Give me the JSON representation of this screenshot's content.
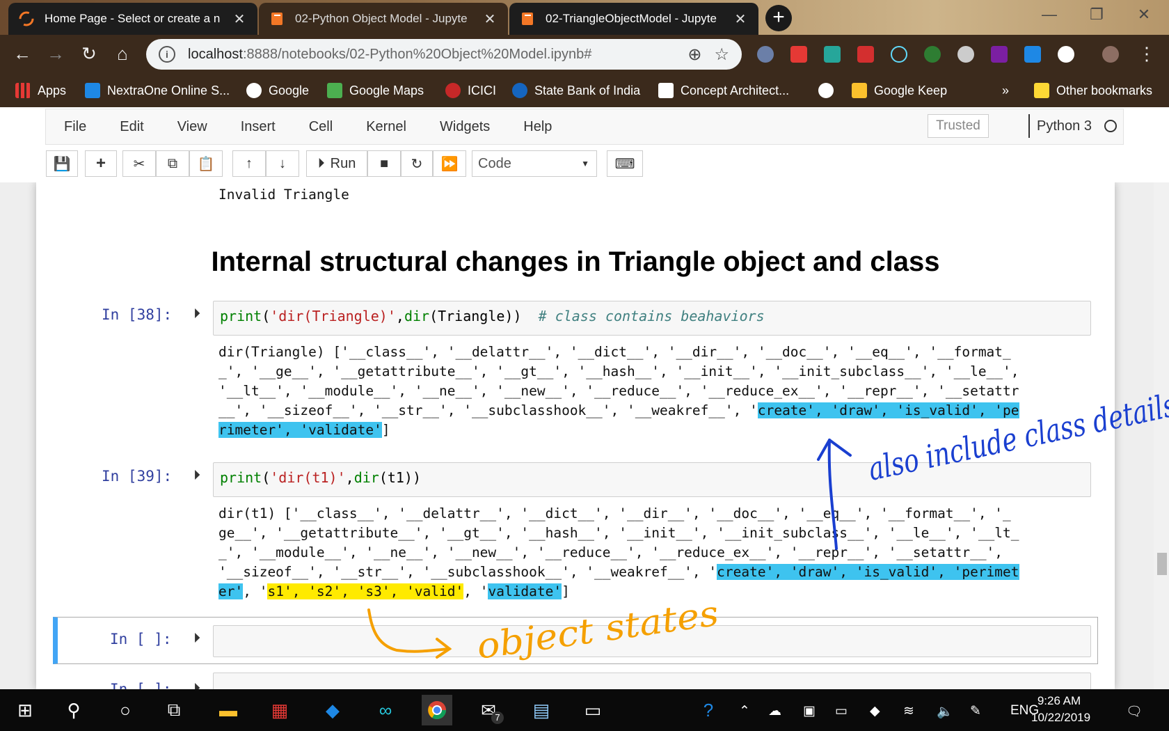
{
  "browser": {
    "tabs": [
      {
        "title": "Home Page - Select or create a n",
        "active": false
      },
      {
        "title": "02-Python Object Model - Jupyte",
        "active": true
      },
      {
        "title": "02-TriangleObjectModel - Jupyte",
        "active": false
      }
    ],
    "url_host": "localhost",
    "url_path": ":8888/notebooks/02-Python%20Object%20Model.ipynb#",
    "bookmarks": [
      "Apps",
      "NextraOne Online S...",
      "Google",
      "Google Maps",
      "ICICI",
      "State Bank of India",
      "Concept Architect...",
      "Google Keep",
      "»",
      "Other bookmarks"
    ]
  },
  "jupyter": {
    "menus": [
      "File",
      "Edit",
      "View",
      "Insert",
      "Cell",
      "Kernel",
      "Widgets",
      "Help"
    ],
    "trusted": "Trusted",
    "kernel": "Python 3",
    "run_label": "Run",
    "cell_type": "Code"
  },
  "notebook": {
    "prev_output": "Invalid Triangle",
    "heading": "Internal structural changes in Triangle object and class",
    "cell38": {
      "prompt": "In [38]:",
      "code_fn": "print",
      "code_open": "(",
      "code_str": "'dir(Triangle)'",
      "code_comma": ",",
      "code_fn2": "dir",
      "code_rest": "(Triangle))  ",
      "code_comment": "# class contains beahaviors",
      "output_line1": "dir(Triangle) ['__class__', '__delattr__', '__dict__', '__dir__', '__doc__', '__eq__', '__format_",
      "output_line2": "_', '__ge__', '__getattribute__', '__gt__', '__hash__', '__init__', '__init_subclass__', '__le__',",
      "output_line3": "'__lt__', '__module__', '__ne__', '__new__', '__reduce__', '__reduce_ex__', '__repr__', '__setattr",
      "output_line4_a": "__', '__sizeof__', '__str__', '__subclasshook__', '__weakref__', '",
      "output_line4_b": "create', 'draw', 'is_valid', 'pe",
      "output_line5_a": "rimeter', 'validate'",
      "output_line5_b": "]"
    },
    "cell39": {
      "prompt": "In [39]:",
      "code_fn": "print",
      "code_open": "(",
      "code_str": "'dir(t1)'",
      "code_comma": ",",
      "code_fn2": "dir",
      "code_rest": "(t1))",
      "output_line1": "dir(t1) ['__class__', '__delattr__', '__dict__', '__dir__', '__doc__', '__eq__', '__format__', '_",
      "output_line2": "ge__', '__getattribute__', '__gt__', '__hash__', '__init__', '__init_subclass__', '__le__', '__lt_",
      "output_line3": "_', '__module__', '__ne__', '__new__', '__reduce__', '__reduce_ex__', '__repr__', '__setattr__',",
      "output_line4_a": "'__sizeof__', '__str__', '__subclasshook__', '__weakref__', '",
      "output_line4_b": "create', 'draw', 'is_valid', 'perimet",
      "output_line5_a": "er'",
      "output_line5_b": ", '",
      "output_line5_c": "s1', 's2', 's3', 'valid'",
      "output_line5_d": ", '",
      "output_line5_e": "validate'",
      "output_line5_f": "]"
    },
    "empty_prompt": "In [ ]:",
    "empty_prompt2": "In [ ]:"
  },
  "annotations": {
    "blue_note": "also include class details",
    "orange_note": "object states"
  },
  "taskbar": {
    "language": "ENG",
    "time": "9:26 AM",
    "date": "10/22/2019",
    "mail_badge": "7"
  }
}
